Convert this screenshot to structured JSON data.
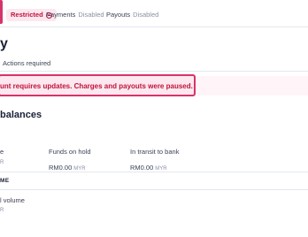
{
  "status": {
    "badge_label": "Restricted",
    "payments_label": "Payments",
    "payments_state": "Disabled",
    "payouts_label": "Payouts",
    "payouts_state": "Disabled"
  },
  "page_title": "y",
  "tab_actions": "Actions required",
  "alert_text": "unt requires updates. Charges and payouts were paused.",
  "balances_title": "balances",
  "balances": {
    "col1_label": "e",
    "col1_cur": "R",
    "on_hold_label": "Funds on hold",
    "on_hold_value": "RM0.00",
    "on_hold_cur": "MYR",
    "in_transit_label": "In transit to bank",
    "in_transit_value": "RM0.00",
    "in_transit_cur": "MYR"
  },
  "section_label": "ME",
  "volume_label": "l volume",
  "volume_cur": "R",
  "colors": {
    "accent_red": "#d6336c",
    "alert_bg": "#fde8ef",
    "text": "#1a1f36",
    "muted": "#8792a2"
  }
}
